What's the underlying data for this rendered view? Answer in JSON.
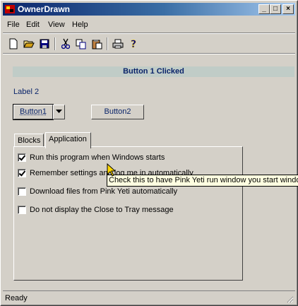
{
  "window": {
    "title": "OwnerDrawn"
  },
  "menu": [
    {
      "label": "File",
      "u": "F"
    },
    {
      "label": "Edit",
      "u": "E"
    },
    {
      "label": "View",
      "u": "V"
    },
    {
      "label": "Help",
      "u": "H"
    }
  ],
  "toolbar": [
    "new-file-icon",
    "open-folder-icon",
    "save-icon",
    "cut-icon",
    "copy-icon",
    "paste-icon",
    "print-icon",
    "help-icon"
  ],
  "banner": {
    "text": "Button 1 Clicked"
  },
  "label2": "Label 2",
  "buttons": {
    "button1": "Button1",
    "button2": "Button2"
  },
  "tabs": {
    "blocks": "Blocks",
    "application": "Application"
  },
  "options": [
    {
      "label": "Run this program when Windows starts",
      "checked": true
    },
    {
      "label": "Remember settings and log me in automatically",
      "checked": true
    },
    {
      "label": "Download files from Pink Yeti automatically",
      "checked": false
    },
    {
      "label": "Do not display the Close to Tray message",
      "checked": false
    }
  ],
  "tooltip": "Check this to have Pink Yeti run window you start windows",
  "status": "Ready",
  "colors": {
    "titlebar_start": "#0a246a",
    "titlebar_end": "#a6caf0",
    "face": "#d4d0c8",
    "tooltip_bg": "#ffffe1"
  }
}
